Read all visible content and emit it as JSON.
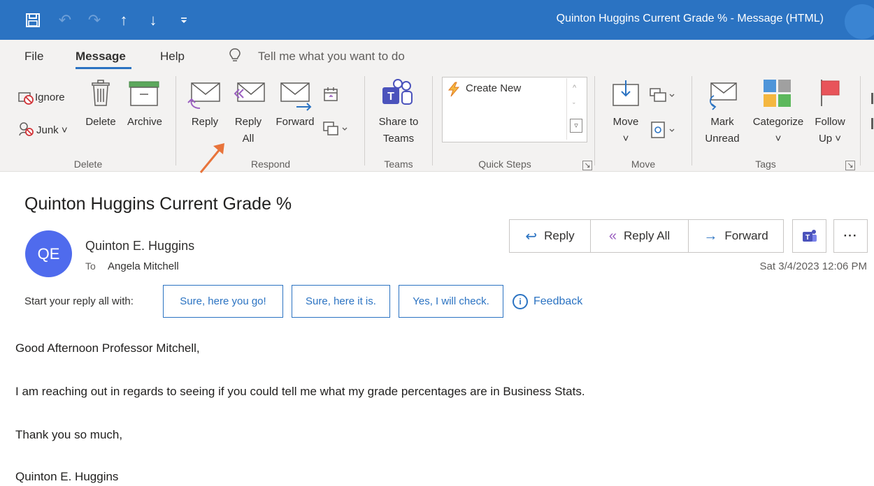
{
  "window": {
    "title": "Quinton Huggins Current Grade %  -  Message (HTML)",
    "quick_access": {
      "save": "🖫",
      "undo": "↶",
      "redo": "↷",
      "up": "↑",
      "down": "↓",
      "customize": "⩡"
    }
  },
  "menu": {
    "file": "File",
    "message": "Message",
    "help": "Help",
    "tell_me": "Tell me what you want to do"
  },
  "ribbon": {
    "delete_group": {
      "label": "Delete",
      "ignore": "Ignore",
      "junk": "Junk ˅",
      "delete": "Delete",
      "archive": "Archive"
    },
    "respond_group": {
      "label": "Respond",
      "reply": "Reply",
      "reply_all_1": "Reply",
      "reply_all_2": "All",
      "forward": "Forward"
    },
    "teams_group": {
      "label": "Teams",
      "share_1": "Share to",
      "share_2": "Teams"
    },
    "quick_steps_group": {
      "label": "Quick Steps",
      "create_new": "Create New"
    },
    "move_group": {
      "label": "Move",
      "move": "Move",
      "move_chevron": "˅"
    },
    "tags_group": {
      "label": "Tags",
      "mark_1": "Mark",
      "mark_2": "Unread",
      "categorize": "Categorize",
      "categorize_chevron": "˅",
      "follow_1": "Follow",
      "follow_2": "Up ˅"
    }
  },
  "email": {
    "subject": "Quinton Huggins Current Grade %",
    "avatar_initials": "QE",
    "sender": "Quinton E. Huggins",
    "to_label": "To",
    "to_name": "Angela Mitchell",
    "date": "Sat 3/4/2023 12:06 PM",
    "actions": {
      "reply": "Reply",
      "reply_all": "Reply All",
      "forward": "Forward",
      "more": "···"
    },
    "suggest_label": "Start your reply all with:",
    "suggestions": [
      "Sure, here you go!",
      "Sure, here it is.",
      "Yes, I will check."
    ],
    "feedback": "Feedback",
    "body": [
      "Good Afternoon Professor Mitchell,",
      "I am reaching out in regards to seeing if you could tell me what my grade percentages are in Business Stats.",
      "Thank you so much,",
      "Quinton E. Huggins"
    ]
  },
  "colors": {
    "accent": "#2b73c2",
    "avatar": "#4f6bed",
    "annotation_arrow": "#e8743b",
    "teams": "#4b53bc"
  }
}
